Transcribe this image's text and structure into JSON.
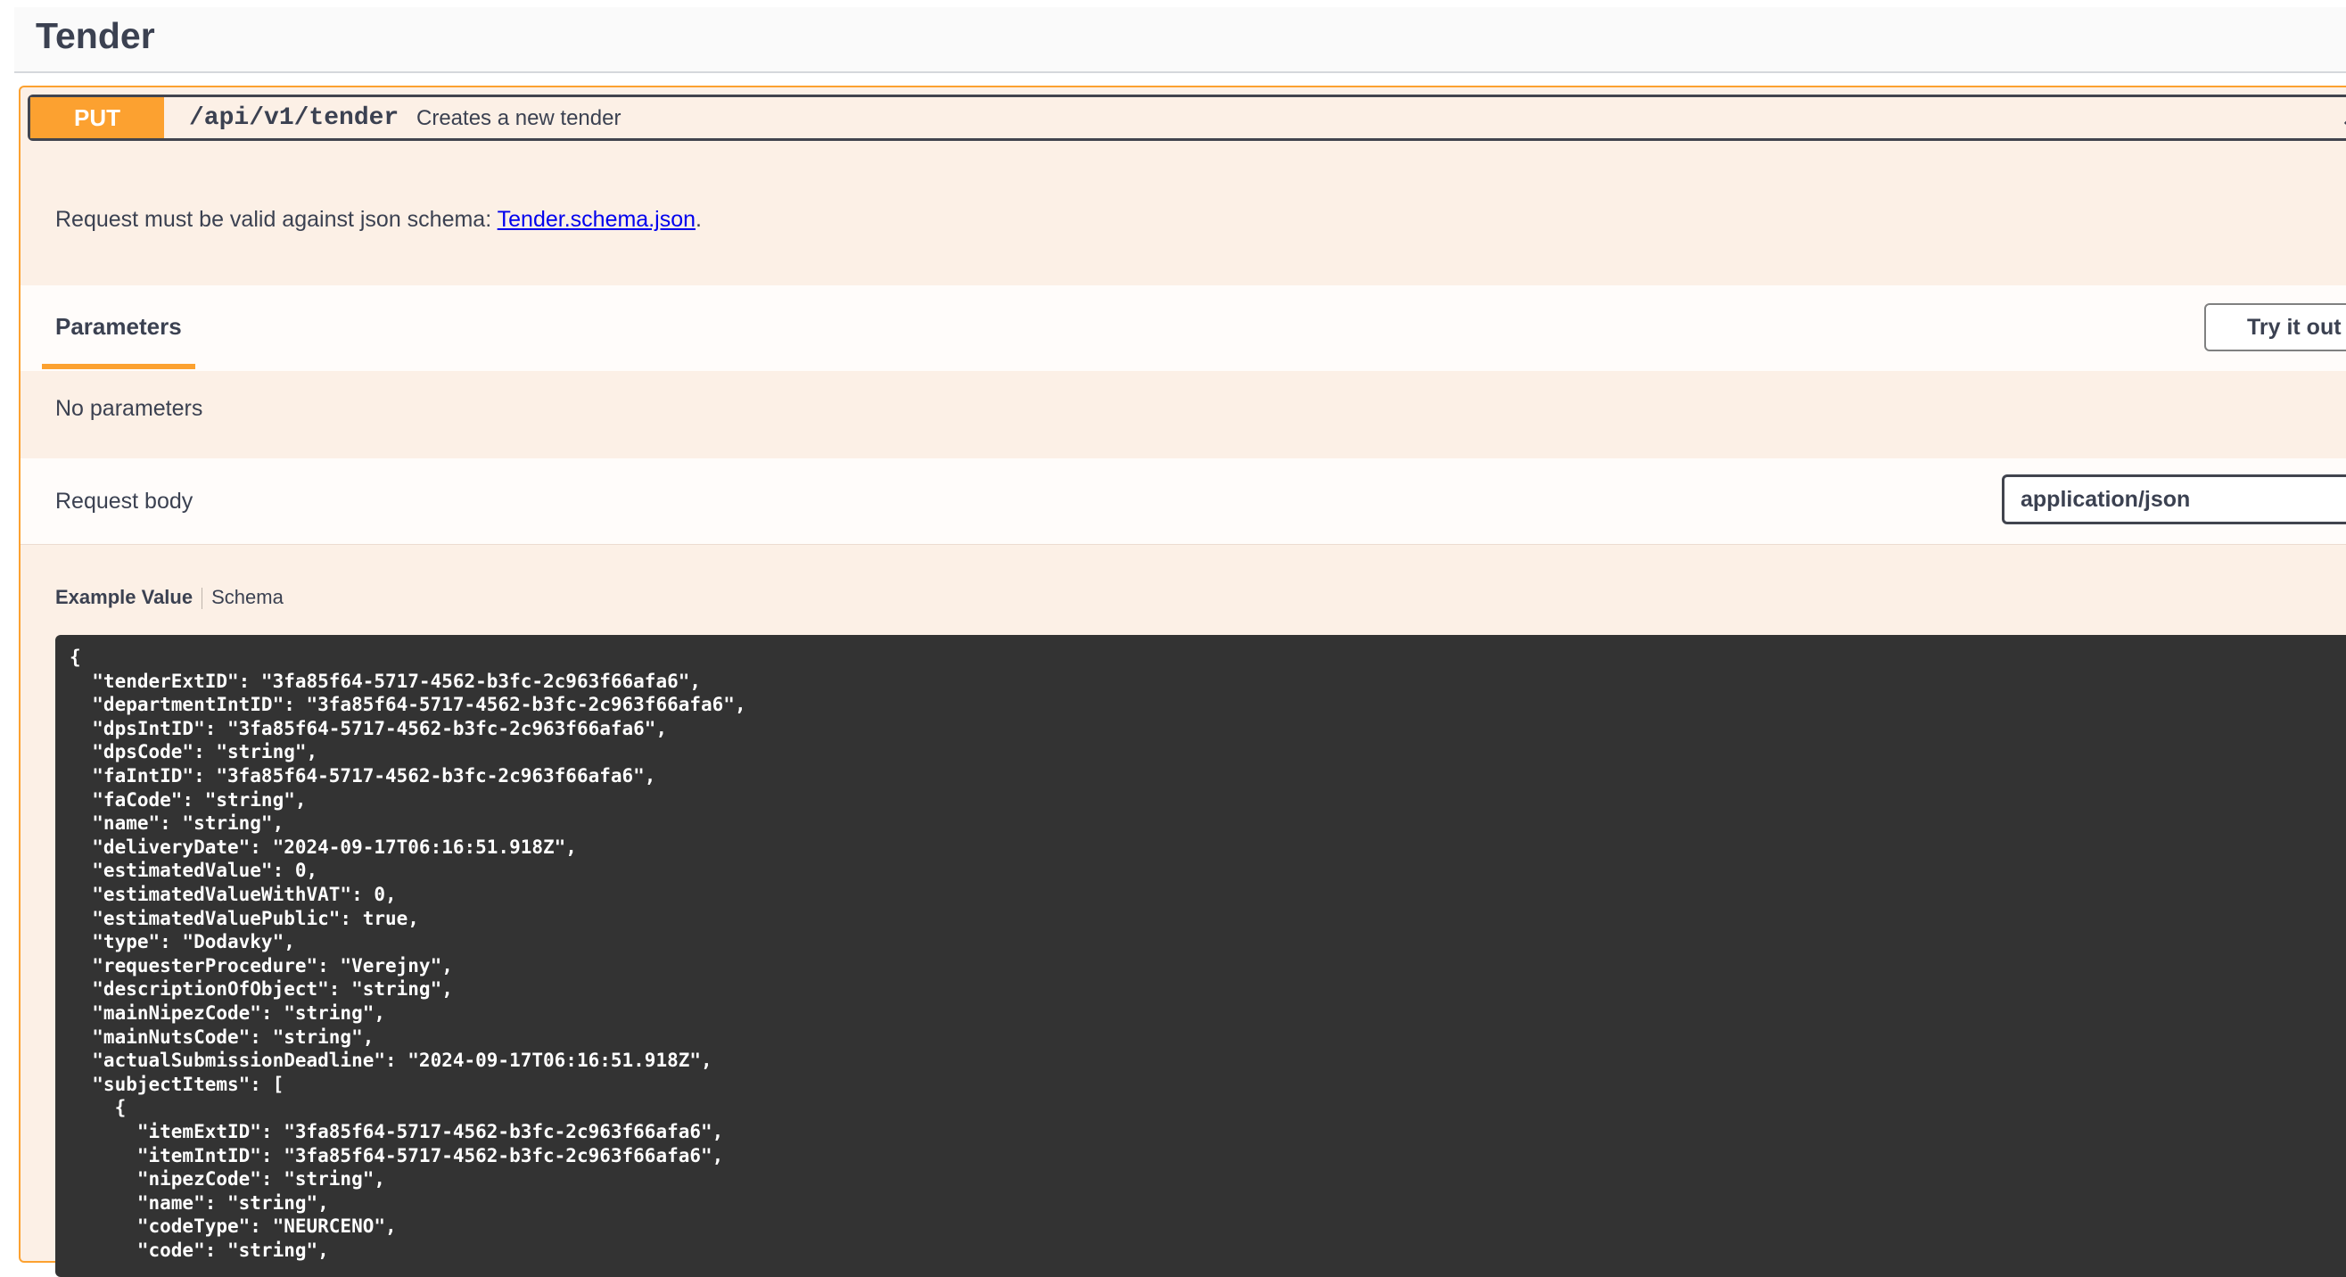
{
  "section": {
    "title": "Tender"
  },
  "operation": {
    "method": "PUT",
    "path": "/api/v1/tender",
    "summary": "Creates a new tender",
    "collapse_icon": "chevron-up-icon",
    "description_prefix": "Request must be valid against json schema: ",
    "description_link": "Tender.schema.json",
    "description_suffix": "."
  },
  "parameters": {
    "tab_label": "Parameters",
    "try_button": "Try it out",
    "empty_text": "No parameters"
  },
  "request_body": {
    "label": "Request body",
    "content_type": "application/json"
  },
  "example": {
    "tabs": [
      "Example Value",
      "Schema"
    ],
    "code_lines": [
      "{",
      "  \"tenderExtID\": \"3fa85f64-5717-4562-b3fc-2c963f66afa6\",",
      "  \"departmentIntID\": \"3fa85f64-5717-4562-b3fc-2c963f66afa6\",",
      "  \"dpsIntID\": \"3fa85f64-5717-4562-b3fc-2c963f66afa6\",",
      "  \"dpsCode\": \"string\",",
      "  \"faIntID\": \"3fa85f64-5717-4562-b3fc-2c963f66afa6\",",
      "  \"faCode\": \"string\",",
      "  \"name\": \"string\",",
      "  \"deliveryDate\": \"2024-09-17T06:16:51.918Z\",",
      "  \"estimatedValue\": 0,",
      "  \"estimatedValueWithVAT\": 0,",
      "  \"estimatedValuePublic\": true,",
      "  \"type\": \"Dodavky\",",
      "  \"requesterProcedure\": \"Verejny\",",
      "  \"descriptionOfObject\": \"string\",",
      "  \"mainNipezCode\": \"string\",",
      "  \"mainNutsCode\": \"string\",",
      "  \"actualSubmissionDeadline\": \"2024-09-17T06:16:51.918Z\",",
      "  \"subjectItems\": [",
      "    {",
      "      \"itemExtID\": \"3fa85f64-5717-4562-b3fc-2c963f66afa6\",",
      "      \"itemIntID\": \"3fa85f64-5717-4562-b3fc-2c963f66afa6\",",
      "      \"nipezCode\": \"string\",",
      "      \"name\": \"string\",",
      "      \"codeType\": \"NEURCENO\",",
      "      \"code\": \"string\","
    ]
  },
  "colors": {
    "put_accent": "#fca130",
    "opblock_bg": "#fcf0e6",
    "code_bg": "#333333",
    "link": "#0000ee"
  }
}
